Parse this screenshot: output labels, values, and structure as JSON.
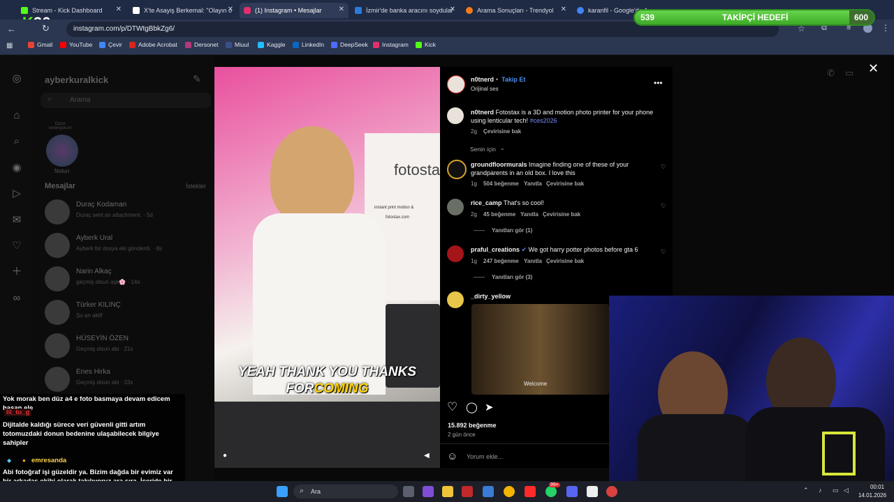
{
  "browser": {
    "tabs": [
      {
        "label": "Stream - Kick Dashboard",
        "color": "#53fc18"
      },
      {
        "label": "X'te Asayiş Berkemal: \"Olayın o",
        "color": "#ffffff"
      },
      {
        "label": "(1) Instagram • Mesajlar",
        "color": "#e1306c"
      },
      {
        "label": "İzmir'de banka aracını soydular",
        "color": "#2b7bd6"
      },
      {
        "label": "Arama Sonuçları - Trendyol",
        "color": "#f27a1a"
      },
      {
        "label": "karanfil - Google'da Ara",
        "color": "#4285f4"
      }
    ],
    "url": "instagram.com/p/DTWtgBbkZg6/",
    "bookmarks": [
      "Gmail",
      "YouTube",
      "Çevir",
      "Adobe Acrobat",
      "Dersonet",
      "Miuul",
      "Kaggle",
      "LinkedIn",
      "DeepSeek",
      "Instagram",
      "Kick"
    ]
  },
  "overlay": {
    "kick_logo": "36",
    "goal_current": "539",
    "goal_label": "TAKİPÇİ HEDEFİ",
    "goal_target": "600",
    "goal_progress": 0.898
  },
  "instagram": {
    "username": "ayberkuralkick",
    "search_placeholder": "Arama",
    "note_bubble": "Dizisi vereniyorum",
    "note_label": "Notun",
    "messages_heading": "Mesajlar",
    "requests_label": "İstekler",
    "conversations": [
      {
        "name": "Duraç Kodaman",
        "preview": "Duraç sent an attachment. · 5d"
      },
      {
        "name": "Ayberk Ural",
        "preview": "Ayberk bir dosya eki gönderdi. · 8s"
      },
      {
        "name": "Narin Alkaç",
        "preview": "geçmiş olsun aşk🌸 · 14s"
      },
      {
        "name": "Türker KILINÇ",
        "preview": "Şu an aktif"
      },
      {
        "name": "HÜSEYİN ÖZEN",
        "preview": "Geçmiş olsun abi · 21s"
      },
      {
        "name": "Enes Hirka",
        "preview": "Geçmiş olsun abi · 23s"
      }
    ]
  },
  "post": {
    "author": "n0tnerd",
    "follow_label": "Takip Et",
    "audio": "Orijinal ses",
    "caption_user": "n0tnerd",
    "caption": "Fotostax is a 3D and motion photo printer for your phone using lenticular tech!",
    "hashtag": "#ces2026",
    "caption_age": "2g",
    "translate_label": "Çevirisine bak",
    "sort_label": "Senin için",
    "video_caption_1": "YEAH THANK YOU THANKS",
    "video_caption_2a": "FOR",
    "video_caption_2b": "COMING",
    "booth_brand": "fotostax",
    "booth_tagline": "instant print motion &",
    "booth_url": "fotostax.com",
    "comments": [
      {
        "user": "groundfloormurals",
        "text": "Imagine finding one of these of your grandparents in an old box. I love this",
        "age": "1g",
        "likes": "504 beğenme",
        "reply": "Yanıtla",
        "translate": "Çevirisine bak",
        "replies": ""
      },
      {
        "user": "rice_camp",
        "text": "That's so cool!",
        "age": "2g",
        "likes": "45 beğenme",
        "reply": "Yanıtla",
        "translate": "Çevirisine bak",
        "replies": "Yanıtları gör (1)"
      },
      {
        "user": "praful_creations",
        "text": "We got harry potter photos before gta 6",
        "age": "1g",
        "likes": "247 beğenme",
        "reply": "Yanıtla",
        "translate": "Çevirisine bak",
        "replies": "Yanıtları gör (3)"
      },
      {
        "user": "_dirty_yellow",
        "text": "",
        "age": "",
        "likes": "",
        "reply": "",
        "translate": "",
        "replies": ""
      }
    ],
    "gif_caption": "Welcome",
    "likes_total": "15.892 beğenme",
    "posted": "2 gün önce",
    "comment_placeholder": "Yorum ekle..."
  },
  "chat": {
    "lines": [
      {
        "user": "",
        "text": "Yok morak ben düz a4 e foto basmaya devam edicem hasan ele"
      },
      {
        "user": "lil_tu_g",
        "text": "Dijitalde kaldığı sürece veri güvenli gitti artım totomuzdaki donun bedenine ulaşabilecek bilgiye sahipler"
      },
      {
        "user": "emresanda",
        "text": "Abi fotoğraf işi güzeldir ya. Bizim dağda bir evimiz var bir arkadaş ekibi olarak takılıyoruz ara sıra. İçeride bir fotoğraflar var duvarda asılı yuvalar yıkılır"
      }
    ]
  },
  "taskbar": {
    "search_label": "Ara",
    "time": "00:01",
    "date": "14.01.2026",
    "badge": "99+"
  }
}
